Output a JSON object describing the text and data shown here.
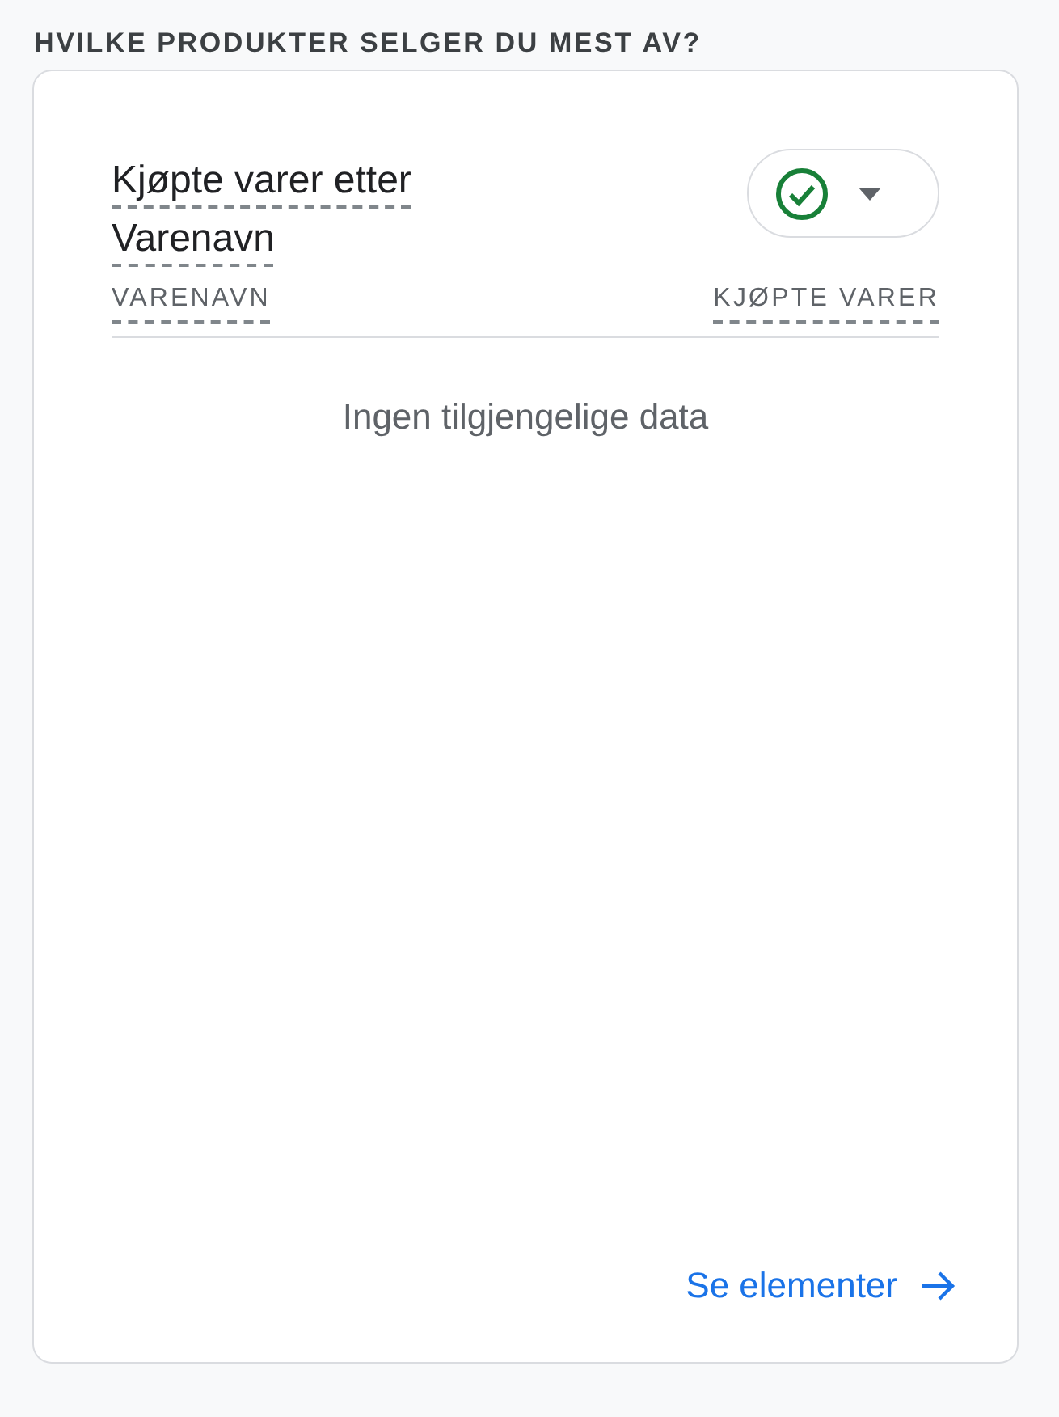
{
  "heading": "HVILKE PRODUKTER SELGER DU MEST AV?",
  "card": {
    "title": "Kjøpte varer etter Varenavn",
    "columns": [
      "VARENAVN",
      "KJØPTE VARER"
    ],
    "empty_message": "Ingen tilgjengelige data",
    "link": "Se elementer"
  }
}
